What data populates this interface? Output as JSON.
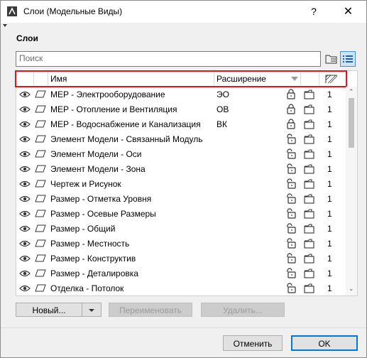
{
  "window": {
    "title": "Слои (Модельные Виды)"
  },
  "titlebar": {
    "help": "?",
    "close": "✕"
  },
  "section": {
    "label": "Слои"
  },
  "search": {
    "placeholder": "Поиск",
    "value": ""
  },
  "columns": {
    "name": "Имя",
    "extension": "Расширение"
  },
  "layers": [
    {
      "name": "MEP - Электрооборудование",
      "ext": "ЭО",
      "locked": true,
      "num": "1"
    },
    {
      "name": "MEP - Отопление и Вентиляция",
      "ext": "ОВ",
      "locked": true,
      "num": "1"
    },
    {
      "name": "MEP - Водоснабжение и Канализация",
      "ext": "ВК",
      "locked": true,
      "num": "1"
    },
    {
      "name": "Элемент Модели - Связанный Модуль",
      "ext": "",
      "locked": false,
      "num": "1"
    },
    {
      "name": "Элемент Модели - Оси",
      "ext": "",
      "locked": false,
      "num": "1"
    },
    {
      "name": "Элемент Модели - Зона",
      "ext": "",
      "locked": false,
      "num": "1"
    },
    {
      "name": "Чертеж и Рисунок",
      "ext": "",
      "locked": false,
      "num": "1"
    },
    {
      "name": "Размер - Отметка Уровня",
      "ext": "",
      "locked": false,
      "num": "1"
    },
    {
      "name": "Размер - Осевые Размеры",
      "ext": "",
      "locked": false,
      "num": "1"
    },
    {
      "name": "Размер - Общий",
      "ext": "",
      "locked": false,
      "num": "1"
    },
    {
      "name": "Размер - Местность",
      "ext": "",
      "locked": false,
      "num": "1"
    },
    {
      "name": "Размер - Конструктив",
      "ext": "",
      "locked": false,
      "num": "1"
    },
    {
      "name": "Размер - Деталировка",
      "ext": "",
      "locked": false,
      "num": "1"
    },
    {
      "name": "Отделка - Потолок",
      "ext": "",
      "locked": false,
      "num": "1"
    }
  ],
  "buttons": {
    "new": "Новый...",
    "rename": "Переименовать",
    "delete": "Удалить...",
    "cancel": "Отменить",
    "ok": "OK"
  },
  "colors": {
    "highlight": "#e0161e",
    "accent": "#0078d7"
  }
}
